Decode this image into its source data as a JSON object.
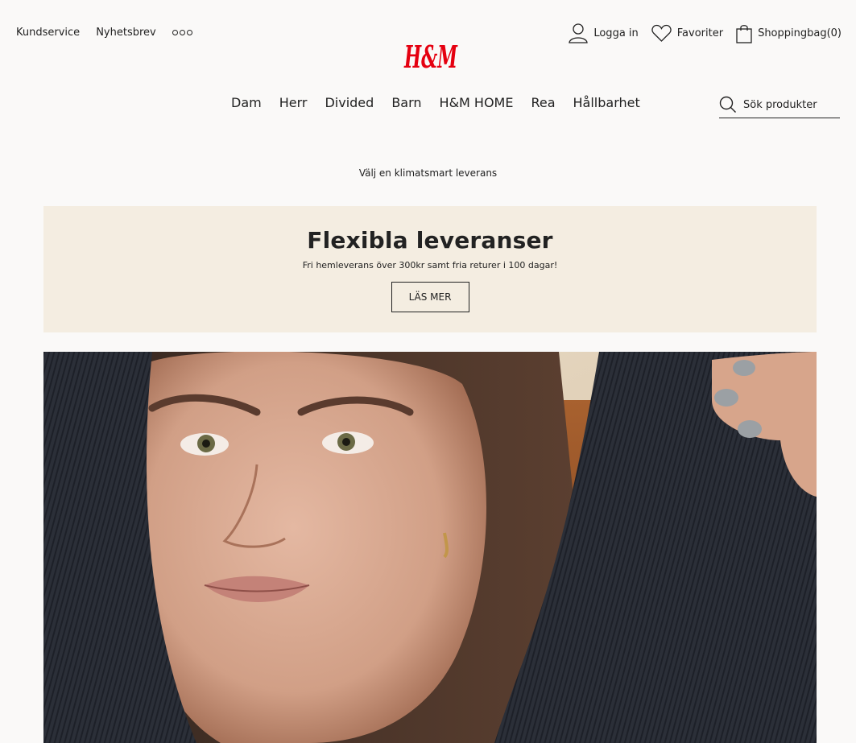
{
  "topbar": {
    "customer_service": "Kundservice",
    "newsletter": "Nyhetsbrev",
    "more_icon": "more-dots-icon"
  },
  "logo": {
    "text": "H&M",
    "color": "#e50010"
  },
  "account": {
    "login": "Logga in",
    "favorites": "Favoriter",
    "bag": "Shoppingbag(0)"
  },
  "nav": {
    "items": [
      "Dam",
      "Herr",
      "Divided",
      "Barn",
      "H&M HOME",
      "Rea",
      "Hållbarhet"
    ]
  },
  "search": {
    "placeholder": "Sök produkter",
    "icon": "search-icon"
  },
  "notice": "Välj en klimatsmart leverans",
  "banner": {
    "title": "Flexibla leveranser",
    "subtitle": "Fri hemleverans över 300kr samt fria returer i 100 dagar!",
    "button": "LÄS MER",
    "background": "#f4ede1"
  }
}
